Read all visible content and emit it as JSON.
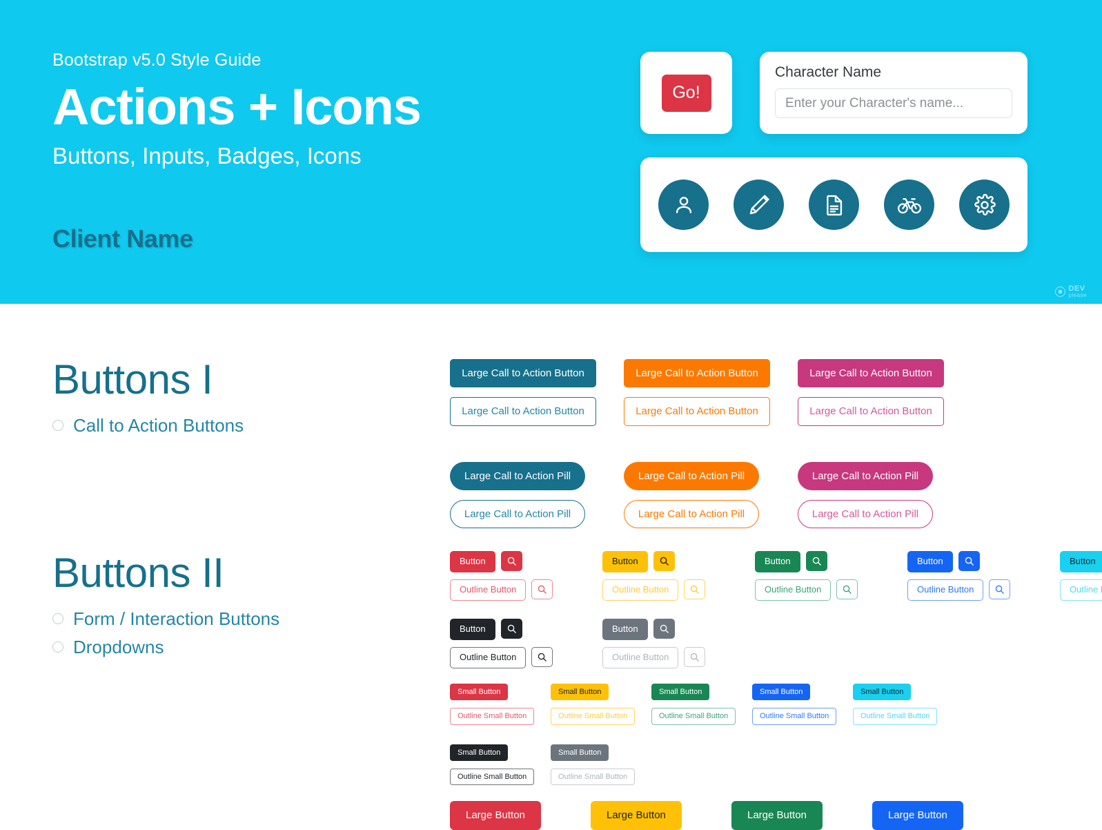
{
  "header": {
    "eyebrow": "Bootstrap v5.0 Style Guide",
    "title": "Actions + Icons",
    "subtitle": "Buttons, Inputs, Badges, Icons",
    "client_name": "Client Name",
    "go_button": "Go!",
    "name_card": {
      "label": "Character Name",
      "placeholder": "Enter your Character's name...",
      "value": ""
    },
    "icons": [
      {
        "name": "person-icon"
      },
      {
        "name": "pencil-icon"
      },
      {
        "name": "document-icon"
      },
      {
        "name": "bicycle-icon"
      },
      {
        "name": "gear-icon"
      }
    ],
    "logo": {
      "line1": "DEV",
      "line2": "please"
    },
    "colors": {
      "background": "#0fc9ef",
      "teal": "#17708c",
      "red": "#dc3545"
    }
  },
  "sections": [
    {
      "title": "Buttons I",
      "bullets": [
        "Call to Action Buttons"
      ]
    },
    {
      "title": "Buttons II",
      "bullets": [
        "Form / Interaction Buttons",
        "Dropdowns"
      ]
    }
  ],
  "cta": {
    "button_label": "Large Call to Action Button",
    "pill_label": "Large Call to Action Pill",
    "variants": [
      {
        "name": "teal",
        "color": "#17708c"
      },
      {
        "name": "orange",
        "color": "#fc7900"
      },
      {
        "name": "magenta",
        "color": "#c7387f"
      }
    ]
  },
  "form_buttons": {
    "button_label": "Button",
    "outline_label": "Outline Button",
    "icon": "search-icon",
    "variants": [
      {
        "name": "danger",
        "color": "#dc3545"
      },
      {
        "name": "warning",
        "color": "#ffc107"
      },
      {
        "name": "success",
        "color": "#198754"
      },
      {
        "name": "primary",
        "color": "#1565f5"
      },
      {
        "name": "info",
        "color": "#1ad0f0"
      },
      {
        "name": "dark",
        "color": "#212529"
      },
      {
        "name": "secondary",
        "color": "#6c757d"
      }
    ]
  },
  "small_buttons": {
    "button_label": "Small Button",
    "outline_label": "Outline Small Button",
    "variants": [
      {
        "name": "danger",
        "color": "#dc3545"
      },
      {
        "name": "warning",
        "color": "#ffc107"
      },
      {
        "name": "success",
        "color": "#198754"
      },
      {
        "name": "primary",
        "color": "#1565f5"
      },
      {
        "name": "info",
        "color": "#1ad0f0"
      },
      {
        "name": "dark",
        "color": "#212529"
      },
      {
        "name": "secondary",
        "color": "#6c757d"
      }
    ]
  },
  "large_buttons": {
    "button_label": "Large Button",
    "variants": [
      {
        "name": "danger",
        "color": "#dc3545"
      },
      {
        "name": "warning",
        "color": "#ffc107"
      },
      {
        "name": "success",
        "color": "#198754"
      },
      {
        "name": "primary",
        "color": "#1565f5"
      }
    ]
  }
}
